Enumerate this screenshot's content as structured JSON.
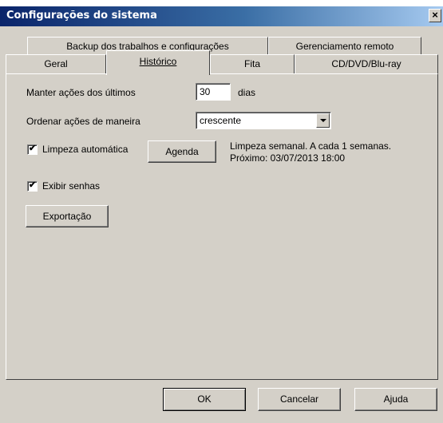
{
  "window": {
    "title": "Configurações do sistema",
    "close": "×"
  },
  "tabs": {
    "row1": [
      {
        "label": "Backup dos trabalhos e configurações"
      },
      {
        "label": "Gerenciamento remoto"
      }
    ],
    "row2": [
      {
        "label": "Geral"
      },
      {
        "label": "Histórico",
        "active": true
      },
      {
        "label": "Fita"
      },
      {
        "label": "CD/DVD/Blu-ray"
      }
    ]
  },
  "historico": {
    "keep_label": "Manter ações dos últimos",
    "keep_value": "30",
    "keep_unit": "dias",
    "order_label": "Ordenar ações de maneira",
    "order_value": "crescente",
    "auto_clean": {
      "label": "Limpeza automática",
      "checked": true
    },
    "schedule_button": "Agenda",
    "schedule_info_1": "Limpeza semanal. A cada 1 semanas.",
    "schedule_info_2": "Próximo: 03/07/2013 18:00",
    "show_passwords": {
      "label": "Exibir senhas",
      "checked": true
    },
    "export_button": "Exportação"
  },
  "footer": {
    "ok": "OK",
    "cancel": "Cancelar",
    "help": "Ajuda"
  },
  "colors": {
    "face": "#d4d0c8",
    "title_start": "#0a246a",
    "title_end": "#a6caf0"
  }
}
